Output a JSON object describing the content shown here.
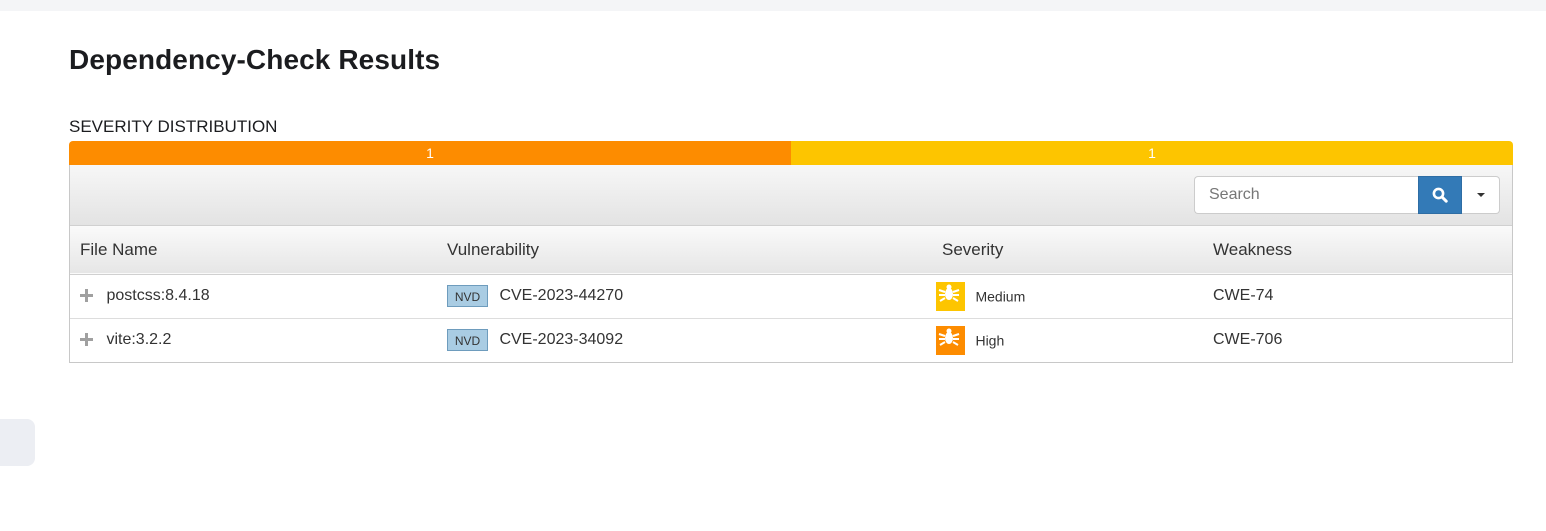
{
  "page": {
    "title": "Dependency-Check Results"
  },
  "severity_distribution": {
    "label": "SEVERITY DISTRIBUTION",
    "segments": [
      {
        "severity": "High",
        "count": "1",
        "color": "#fd8c00",
        "fraction": 0.5
      },
      {
        "severity": "Medium",
        "count": "1",
        "color": "#fdc500",
        "fraction": 0.5
      }
    ]
  },
  "toolbar": {
    "search_placeholder": "Search",
    "search_icon": "search-icon",
    "dropdown_icon": "caret-down-icon",
    "accent": "#337ab7"
  },
  "table": {
    "headers": {
      "file_name": "File Name",
      "vulnerability": "Vulnerability",
      "severity": "Severity",
      "weakness": "Weakness"
    },
    "rows": [
      {
        "file_name": "postcss:8.4.18",
        "source": "NVD",
        "vulnerability": "CVE-2023-44270",
        "severity": "Medium",
        "severity_color": "#fdc500",
        "weakness": "CWE-74"
      },
      {
        "file_name": "vite:3.2.2",
        "source": "NVD",
        "vulnerability": "CVE-2023-34092",
        "severity": "High",
        "severity_color": "#fd8c00",
        "weakness": "CWE-706"
      }
    ]
  }
}
